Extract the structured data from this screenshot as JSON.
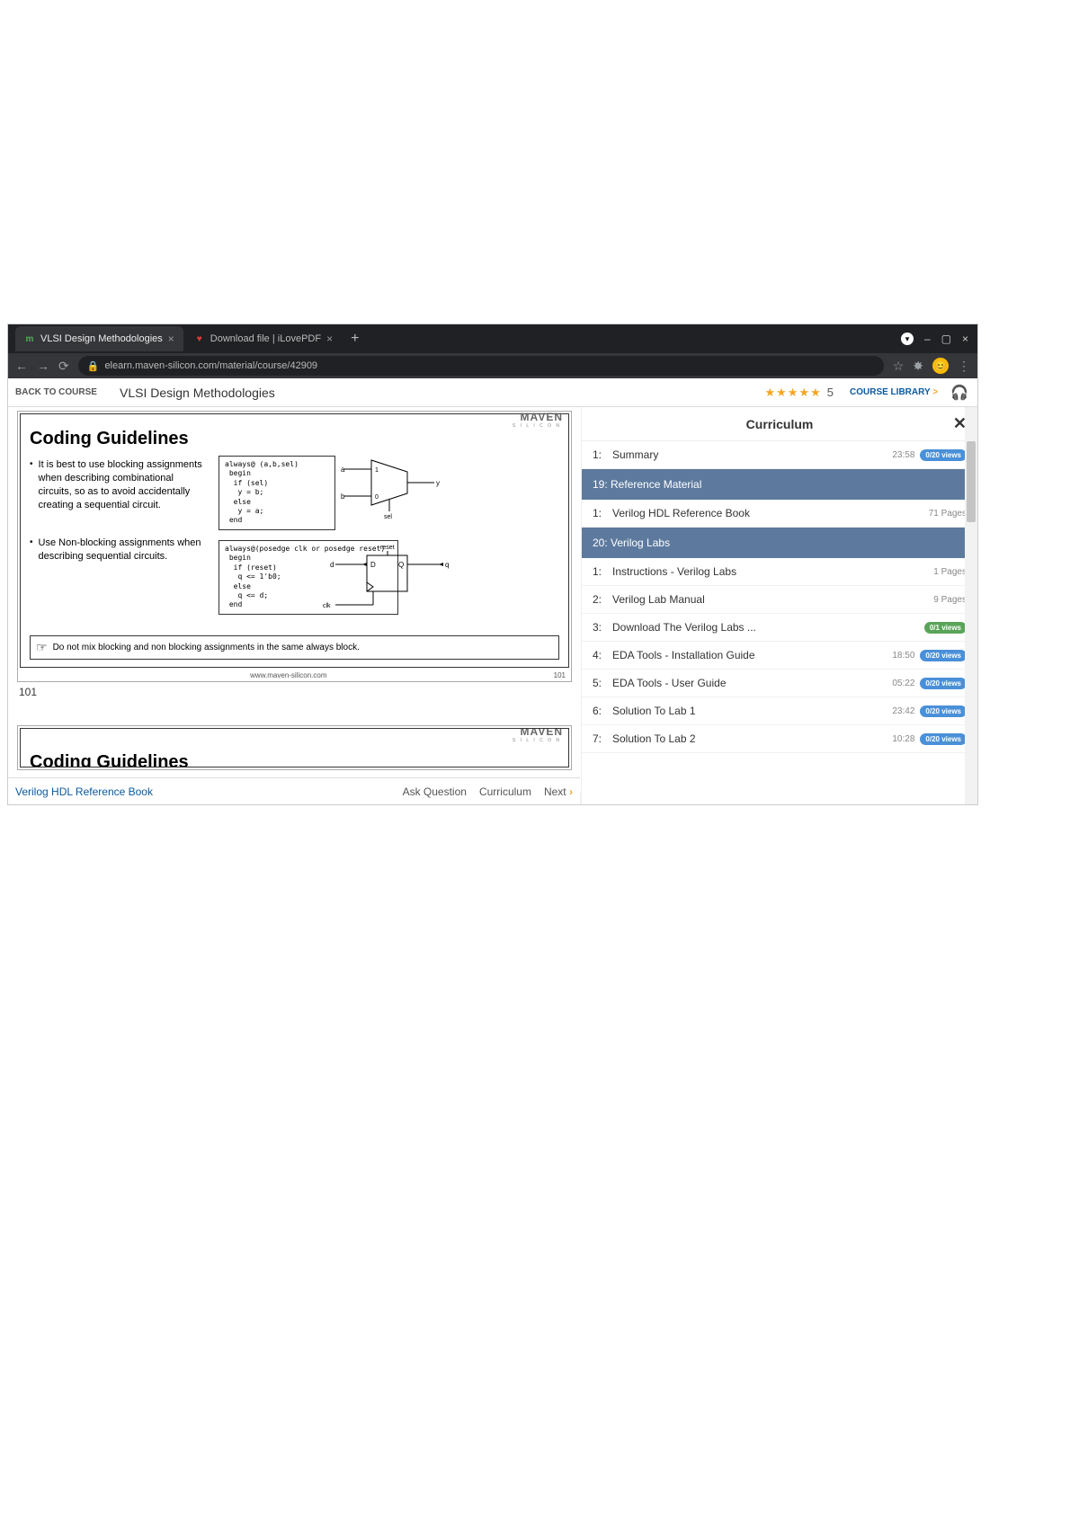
{
  "browser": {
    "tabs": [
      {
        "favicon_letter": "m",
        "favicon_color": "#4caf50",
        "title": "VLSI Design Methodologies",
        "active": true
      },
      {
        "favicon_letter": "♥",
        "favicon_color": "#e53935",
        "title": "Download file | iLovePDF",
        "active": false
      }
    ],
    "url": "elearn.maven-silicon.com/material/course/42909",
    "window_controls": {
      "minimize": "–",
      "maximize": "▢",
      "close": "×"
    }
  },
  "course_bar": {
    "back": "BACK TO COURSE",
    "title": "VLSI Design Methodologies",
    "stars": "★★★★★",
    "rating": "5",
    "library": "COURSE LIBRARY",
    "library_caret": ">"
  },
  "slide": {
    "brand": "MAVEN",
    "brand_sub": "S I L I C O N",
    "title": "Coding Guidelines",
    "bullet1": "It is best to use blocking assignments when describing combinational circuits, so as to avoid accidentally creating a sequential circuit.",
    "bullet2": "Use Non-blocking assignments when describing sequential circuits.",
    "code1": "always@ (a,b,sel)\n begin\n  if (sel)\n   y = b;\n  else\n   y = a;\n end",
    "code2": "always@(posedge clk or posedge reset)\n begin\n  if (reset)\n   q <= 1'b0;\n  else\n   q <= d;\n end",
    "note": "Do not mix blocking and non blocking assignments in the same always block.",
    "footer_url": "www.maven-silicon.com",
    "footer_num": "101",
    "page_label": "101",
    "mux_labels": {
      "a": "a",
      "b": "b",
      "y": "y",
      "sel": "sel",
      "one": "1",
      "zero": "0"
    },
    "dff_labels": {
      "d": "d",
      "D": "D",
      "Q": "Q",
      "q": "q",
      "clk": "clk",
      "reset": "reset"
    }
  },
  "sidebar": {
    "header": "Curriculum",
    "close": "✕",
    "row_summary": {
      "idx": "1:",
      "label": "Summary",
      "time": "23:58",
      "badge": "0/20 views"
    },
    "section19": "19: Reference Material",
    "row_ref": {
      "idx": "1:",
      "label": "Verilog HDL Reference Book",
      "meta": "71 Pages"
    },
    "section20": "20: Verilog Labs",
    "rows": [
      {
        "idx": "1:",
        "label": "Instructions - Verilog Labs",
        "meta": "1 Pages",
        "badge": ""
      },
      {
        "idx": "2:",
        "label": "Verilog Lab Manual",
        "meta": "9 Pages",
        "badge": ""
      },
      {
        "idx": "3:",
        "label": "Download The Verilog Labs ...",
        "meta": "",
        "badge": "0/1 views",
        "badge_class": "green"
      },
      {
        "idx": "4:",
        "label": "EDA Tools - Installation Guide",
        "meta": "18:50",
        "badge": "0/20 views"
      },
      {
        "idx": "5:",
        "label": "EDA Tools - User Guide",
        "meta": "05:22",
        "badge": "0/20 views"
      },
      {
        "idx": "6:",
        "label": "Solution To Lab 1",
        "meta": "23:42",
        "badge": "0/20 views"
      },
      {
        "idx": "7:",
        "label": "Solution To Lab 2",
        "meta": "10:28",
        "badge": "0/20 views"
      }
    ]
  },
  "bottom": {
    "left": "Verilog HDL Reference Book",
    "ask": "Ask Question",
    "curriculum": "Curriculum",
    "next": "Next"
  }
}
